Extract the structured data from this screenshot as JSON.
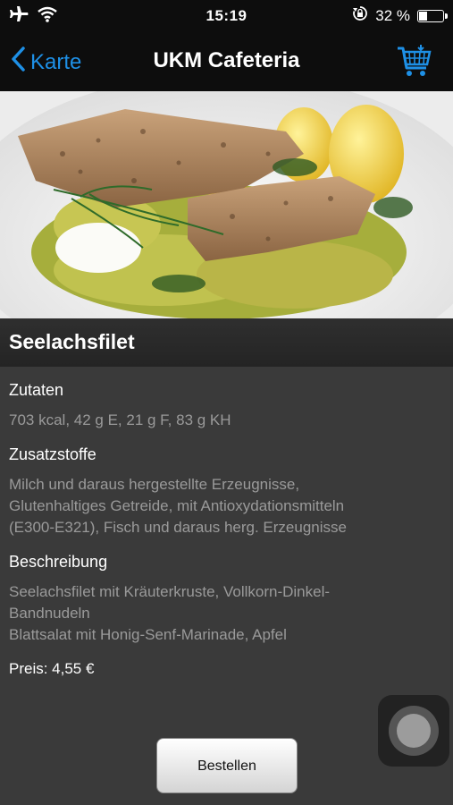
{
  "status_bar": {
    "time": "15:19",
    "battery_text": "32 %",
    "battery_level": 0.32,
    "icons": [
      "airplane-icon",
      "wifi-icon",
      "rotation-lock-icon",
      "battery-icon"
    ]
  },
  "nav": {
    "back_label": "Karte",
    "title": "UKM Cafeteria",
    "cart_icon": "shopping-cart-icon"
  },
  "colors": {
    "accent": "#1e90e6",
    "background": "#3a3a3a",
    "bar": "#0d0d0d"
  },
  "dish": {
    "name": "Seelachsfilet",
    "ingredients_heading": "Zutaten",
    "ingredients": "703 kcal, 42 g E, 21 g F, 83 g KH",
    "additives_heading": "Zusatzstoffe",
    "additives_lines": [
      "Milch und daraus hergestellte Erzeugnisse,",
      "Glutenhaltiges Getreide, mit Antioxydationsmitteln",
      "(E300-E321), Fisch und daraus herg. Erzeugnisse"
    ],
    "description_heading": "Beschreibung",
    "description_lines": [
      "Seelachsfilet mit Kräuterkruste, Vollkorn-Dinkel-",
      "Bandnudeln",
      "Blattsalat mit Honig-Senf-Marinade, Apfel"
    ],
    "price": "Preis: 4,55 €"
  },
  "order_button_label": "Bestellen"
}
